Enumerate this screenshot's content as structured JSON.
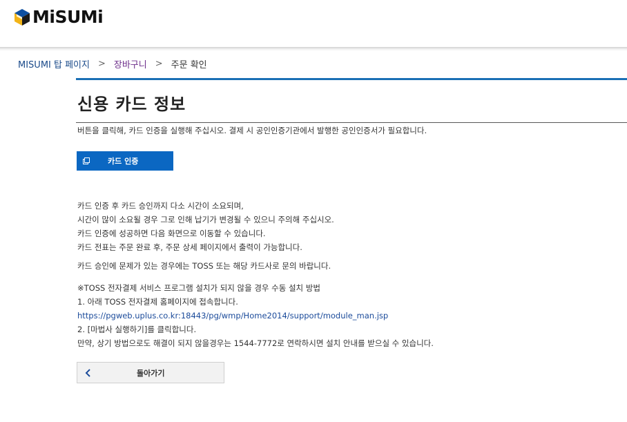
{
  "brand": {
    "name": "MiSUMi"
  },
  "breadcrumb": {
    "home": "MISUMI 탑 페이지",
    "cart": "장바구니",
    "current": "주문 확인",
    "separator": ">"
  },
  "page": {
    "title": "신용 카드 정보",
    "intro": "버튼을 클릭해, 카드 인증을 실행해 주십시오. 결제 시 공인인증기관에서 발행한 공인인증서가 필요합니다."
  },
  "card_button": {
    "label": "카드 인증"
  },
  "notice": {
    "lines": [
      "카드 인증 후 카드 승인까지 다소 시간이 소요되며,",
      "시간이 많이 소요될 경우 그로 인해 납기가 변경될 수 있으니 주의해 주십시오.",
      "카드 인증에 성공하면 다음 화면으로 이동할 수 있습니다.",
      "카드 전표는 주문 완료 후, 주문 상세 페이지에서 출력이 가능합니다."
    ],
    "toss": "카드 승인에 문제가 있는 경우에는 TOSS 또는 해당 카드사로 문의 바랍니다."
  },
  "manual_install": {
    "heading": "※TOSS 전자결제 서비스 프로그램 설치가 되지 않을 경우 수동 설치 방법",
    "step1": "1. 아래 TOSS 전자결제 홈페이지에 접속합니다.",
    "link": "https://pgweb.uplus.co.kr:18443/pg/wmp/Home2014/support/module_man.jsp",
    "step2": "2. [마법사 실행하기]를 클릭합니다.",
    "contact": "만약, 상기 방법으로도 해결이 되지 않을경우는 1544-7772로 연락하시면 설치 안내를 받으실 수 있습니다."
  },
  "back_button": {
    "label": "돌아가기"
  },
  "colors": {
    "accent_blue": "#1a6fb5",
    "button_blue": "#0b67c2",
    "link_blue": "#1a4a9a",
    "cart_purple": "#6d2f8b"
  }
}
